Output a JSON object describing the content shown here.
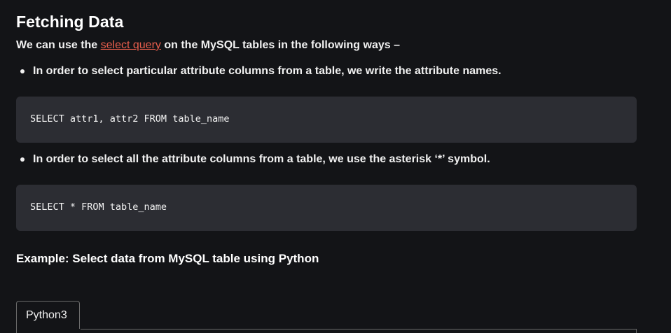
{
  "article": {
    "title": "Fetching Data",
    "intro": {
      "before": "We can use the ",
      "link_text": "select query",
      "after": " on the MySQL tables in the following ways –"
    },
    "bullets": [
      {
        "text": "In order to select particular attribute columns from a table, we write the attribute names.",
        "code": "SELECT attr1, attr2 FROM table_name"
      },
      {
        "text": "In order to select all the attribute columns from a table, we use the asterisk ‘*’ symbol.",
        "code": "SELECT * FROM table_name"
      }
    ],
    "example_heading": "Example: Select data from MySQL table using Python"
  },
  "code_tabs": {
    "tabs": [
      {
        "label": "Python3",
        "selected": true
      }
    ]
  },
  "colors": {
    "background": "#131417",
    "code_background": "#2c2d33",
    "link": "#e95f4d",
    "text": "#f1f1f1"
  }
}
